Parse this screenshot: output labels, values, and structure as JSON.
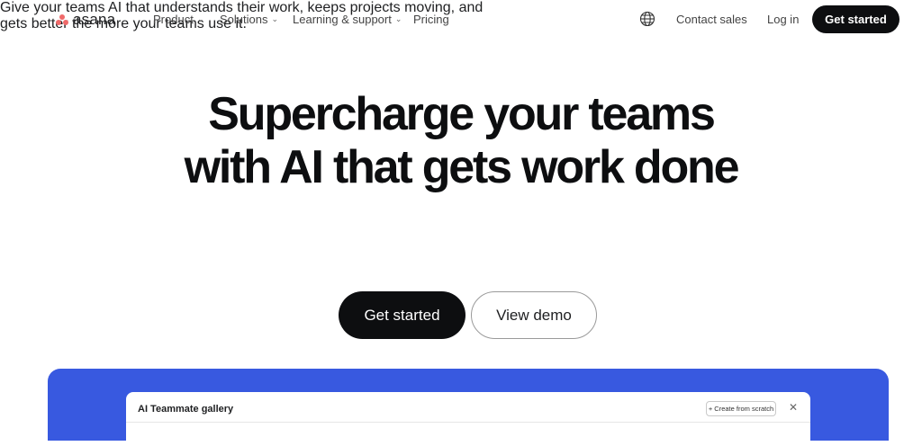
{
  "nav": {
    "logo_text": "asana",
    "items": [
      {
        "label": "Product",
        "has_dropdown": true
      },
      {
        "label": "Solutions",
        "has_dropdown": true
      },
      {
        "label": "Learning & support",
        "has_dropdown": true
      },
      {
        "label": "Pricing",
        "has_dropdown": false
      }
    ],
    "language_icon": "globe-icon",
    "contact_sales": "Contact sales",
    "log_in": "Log in",
    "get_started": "Get started"
  },
  "hero": {
    "title_line1": "Supercharge your teams",
    "title_line2": "with AI that gets work done",
    "subtitle_line1": "Give your teams AI that understands their work, keeps projects moving, and",
    "subtitle_line2": "gets better the more your teams use it.",
    "primary_cta": "Get started",
    "secondary_cta": "View demo"
  },
  "gallery": {
    "title": "AI Teammate gallery",
    "create_button": "+ Create from scratch",
    "close_icon": "close-icon"
  },
  "colors": {
    "brand_coral": "#f06a6a",
    "cta_dark": "#0d0e10",
    "panel_blue": "#3859e0"
  }
}
